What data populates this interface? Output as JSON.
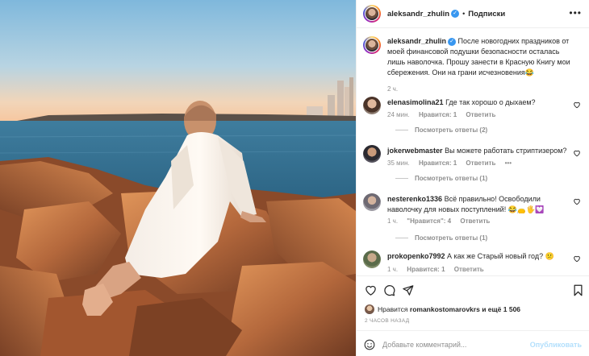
{
  "post": {
    "author": "aleksandr_zhulin",
    "dot": "•",
    "follow_label": "Подписки",
    "more_label": "•••",
    "caption": "После новогодних праздников от моей финансовой подушки безопасности осталась лишь наволочка. Прошу занести в Красную Книгу мои сбережения. Они на грани исчезновения😂",
    "caption_time": "2 ч."
  },
  "comments": [
    {
      "user": "elenasimolina21",
      "text": "Где так хорошо о дыхаем?",
      "time": "24 мин.",
      "likes": "Нравится: 1",
      "reply": "Ответить",
      "replies_label": "Посмотреть ответы (2)"
    },
    {
      "user": "jokerwebmaster",
      "text": "Вы можете работать стриптизером?",
      "time": "35 мин.",
      "likes": "Нравится: 1",
      "reply": "Ответить",
      "extra": "•••",
      "replies_label": "Посмотреть ответы (1)"
    },
    {
      "user": "nesterenko1336",
      "text": "Всё правильно! Освободили наволочку для новых поступлений! 😂👝🖐💟",
      "time": "1 ч.",
      "likes": "\"Нравится\": 4",
      "reply": "Ответить",
      "replies_label": "Посмотреть ответы (1)"
    },
    {
      "user": "prokopenko7992",
      "text": "А как же Старый новый год? 😕",
      "time": "1 ч.",
      "likes": "Нравится: 1",
      "reply": "Ответить"
    }
  ],
  "likes_line": {
    "prefix": "Нравится",
    "user": "romankostomarovkrs",
    "suffix": "и ещё 1 506"
  },
  "post_time": "2 ЧАСОВ НАЗАД",
  "composer": {
    "placeholder": "Добавьте комментарий...",
    "publish_label": "Опубликовать"
  },
  "colors": {
    "accent": "#3897f0",
    "publish_disabled": "#b2dffc",
    "muted": "#8e8e8e"
  },
  "icons": [
    "heart-icon",
    "comment-icon",
    "share-icon",
    "bookmark-icon",
    "emoji-icon",
    "verified-badge-icon"
  ]
}
